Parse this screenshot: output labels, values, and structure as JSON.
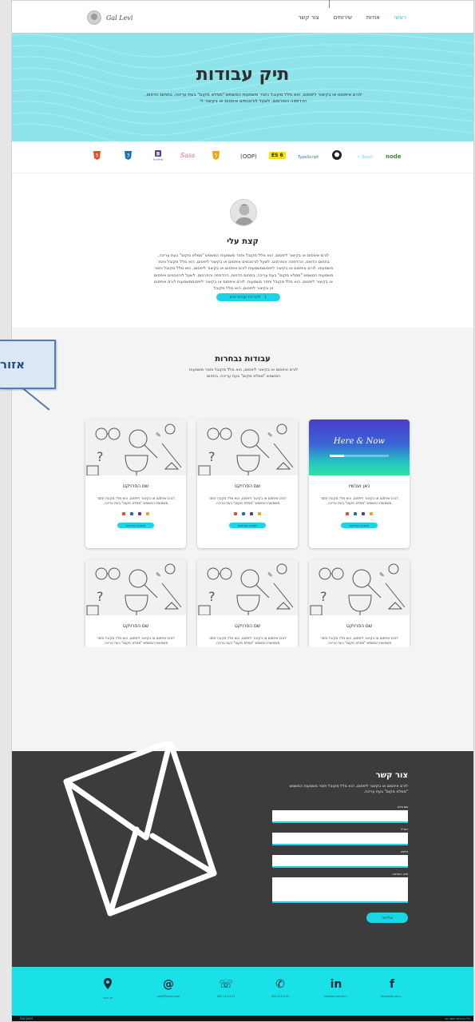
{
  "nav": {
    "logo_text": "Gal Levi",
    "items": [
      {
        "label": "ראשי",
        "active": true
      },
      {
        "label": "אודות",
        "active": false
      },
      {
        "label": "שירותים",
        "active": false
      },
      {
        "label": "צור קשר",
        "active": false
      }
    ]
  },
  "annotation": {
    "label": "אזור"
  },
  "hero": {
    "title": "תיק עבודות",
    "text": "לורם איפסום או בקיצור ליפסום, הוא מלל מקובל וחסר משמעות המשמש \"ממלא מקום\" בעת עריכה, בתחום הדפוס, ההדפסה והפרסום. לשעל לורטכמים איפסום או בקיצור לי"
  },
  "tech": {
    "items": [
      "HTML5",
      "CSS3",
      "Bootstrap",
      "Sass",
      "JavaScript",
      "OOP",
      "ES6",
      "TypeScript",
      "GitHub",
      "React",
      "node"
    ],
    "oop": "(OOP)",
    "es6": "ES 6",
    "typescript": "TypeScript",
    "react": "React",
    "node": "node"
  },
  "about": {
    "title": "קצת עלי",
    "text": "לורם איפסום או בקיצור ליפסום, הוא מלל מקובל וחסר משמעות המשמש \"ממלא מקום\" בעת עריכה, בתחום הדפוס, ההדפסה והפרסום. לשעל לורטכמים איפסום או בקיצור ליפסום, הוא מלל מקובל וחסר משמעות. לורם איפסום או בקיצור ליפסוםמשמעות לורם איפסום או בקיצור ליפסום, הוא מלל מקובל וחסר משמעות המשמש \"ממלא מקום\" בעת עריכה, בתחום הדפוס, ההדפסה והפרסום. לשעל לורטכמים איפסום או בקיצור ליפסום, הוא מלל מקובל וחסר משמעות. לורם איפסום או בקיצור ליפסוםמשמעות לורם איפסום או בקיצור ליפסום, הוא מלל מקובל",
    "cv_button": "להורדת קורות חיים"
  },
  "projects": {
    "title": "עבודות נבחרות",
    "subtitle": "לורם איפסום או בקיצור ליפסום, הוא מלל מקובל וחסר משמעות המשמש \"ממלא מקום\" בעת עריכה, בתחום",
    "cards": [
      {
        "title": "כאן ועכשיו",
        "image": "here-now",
        "image_title": "Here & Now",
        "text": "לורם איפסום או בקיצור ליפסום, הוא מלל מקובל וחסר משמעות המשמש \"ממלא מקום\" בעת עריכה.",
        "button": "לצפייה בפרויקט"
      },
      {
        "title": "שם הפרויקט",
        "image": "doodle",
        "text": "לורם איפסום או בקיצור ליפסום, הוא מלל מקובל וחסר משמעות המשמש \"ממלא מקום\" בעת עריכה.",
        "button": "לצפייה בפרויקט"
      },
      {
        "title": "שם הפרויקט",
        "image": "doodle",
        "text": "לורם איפסום או בקיצור ליפסום, הוא מלל מקובל וחסר משמעות המשמש \"ממלא מקום\" בעת עריכה.",
        "button": "לצפייה בפרויקט"
      },
      {
        "title": "שם הפרויקט",
        "image": "doodle",
        "text": "לורם איפסום או בקיצור ליפסום, הוא מלל מקובל וחסר משמעות המשמש \"ממלא מקום\" בעת עריכה.",
        "button": "לצפייה בפרויקט"
      },
      {
        "title": "שם הפרויקט",
        "image": "doodle",
        "text": "לורם איפסום או בקיצור ליפסום, הוא מלל מקובל וחסר משמעות המשמש \"ממלא מקום\" בעת עריכה.",
        "button": "לצפייה בפרויקט"
      },
      {
        "title": "שם הפרויקט",
        "image": "doodle",
        "text": "לורם איפסום או בקיצור ליפסום, הוא מלל מקובל וחסר משמעות המשמש \"ממלא מקום\" בעת עריכה.",
        "button": "לצפייה בפרויקט"
      }
    ]
  },
  "contact": {
    "title": "צור קשר",
    "subtitle": "לורם איפסום או בקיצור ליפסום, הוא מלל מקובל וחסר משמעות המשמש \"ממלא מקום\" בעת עריכה.",
    "fields": [
      {
        "label": "שם מלא"
      },
      {
        "label": "דוא\"ל"
      },
      {
        "label": "טלפון"
      },
      {
        "label": "תוכן ההודעה"
      }
    ],
    "send_button": "שליחה"
  },
  "footer": {
    "items": [
      {
        "icon": "f",
        "icon_name": "facebook-icon",
        "label": "facebook.com/..."
      },
      {
        "icon": "in",
        "icon_name": "linkedin-icon",
        "label": "linkedin.com/in/..."
      },
      {
        "icon": "✆",
        "icon_name": "phone-icon",
        "label": "050-1111111"
      },
      {
        "icon": "☏",
        "icon_name": "whatsapp-icon",
        "label": "050-1111111"
      },
      {
        "icon": "@",
        "icon_name": "email-icon",
        "label": "mail@gmail.com"
      },
      {
        "icon": "⚲",
        "icon_name": "location-icon",
        "label": "תל אביב"
      }
    ],
    "bottom_left": "Gal Levi",
    "bottom_right": "כל הזכויות שמורות"
  },
  "colors": {
    "accent": "#1ad6e4",
    "hero_bg": "#8ee3ea",
    "contact_bg": "#3c3c3c",
    "footer_bg": "#1ae0e8"
  }
}
